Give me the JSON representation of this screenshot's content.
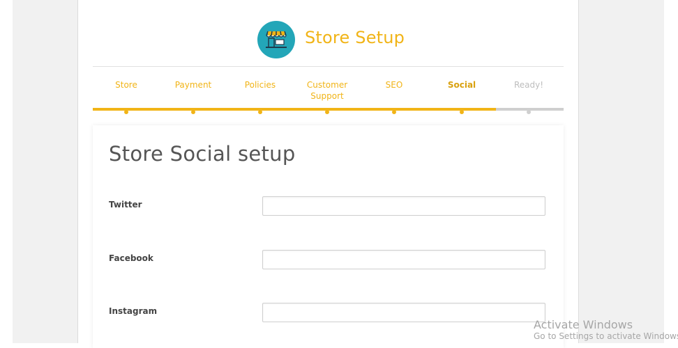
{
  "header": {
    "brand_title": "Store Setup",
    "logo_icon": "storefront-icon",
    "accent_color": "#f1b417",
    "logo_color": "#23a6b8"
  },
  "steps": [
    {
      "label": "Store",
      "state": "done"
    },
    {
      "label": "Payment",
      "state": "done"
    },
    {
      "label": "Policies",
      "state": "done"
    },
    {
      "label": "Customer Support",
      "state": "done"
    },
    {
      "label": "SEO",
      "state": "done"
    },
    {
      "label": "Social",
      "state": "active"
    },
    {
      "label": "Ready!",
      "state": "pending"
    }
  ],
  "progress": {
    "completed_fraction": 0.857
  },
  "form": {
    "title": "Store Social setup",
    "fields": [
      {
        "label": "Twitter",
        "value": "",
        "placeholder": ""
      },
      {
        "label": "Facebook",
        "value": "",
        "placeholder": ""
      },
      {
        "label": "Instagram",
        "value": "",
        "placeholder": ""
      }
    ]
  },
  "watermark": {
    "title": "Activate Windows",
    "subtitle": "Go to Settings to activate Windows."
  }
}
